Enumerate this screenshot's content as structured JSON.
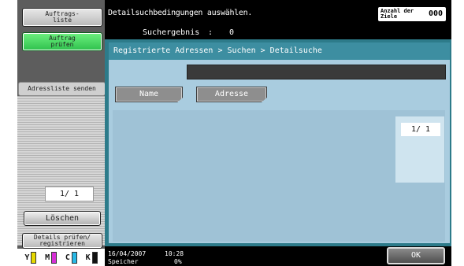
{
  "left_panel": {
    "auftragsliste_label": "Auftrags-\nliste",
    "auftrag_pruefen_label": "Auftrag\nprüfen",
    "adressliste_label": "Adressliste senden",
    "page_indicator": "1/  1",
    "loeschen_label": "Löschen",
    "details_label": "Details prüfen/\nregistrieren",
    "toner": [
      {
        "letter": "Y",
        "color": "#e6d800"
      },
      {
        "letter": "M",
        "color": "#d62fd6"
      },
      {
        "letter": "C",
        "color": "#28b8e6"
      },
      {
        "letter": "K",
        "color": "#111111"
      }
    ]
  },
  "header": {
    "instruction": "Detailsuchbedingungen auswählen.",
    "result_label": "Suchergebnis",
    "result_colon": ":",
    "result_value": "0",
    "counter_label": "Anzahl der\nZiele",
    "counter_value": "000"
  },
  "main": {
    "breadcrumb": "Registrierte Adressen > Suchen > Detailsuche",
    "tabs": [
      {
        "label": "Name"
      },
      {
        "label": "Adresse"
      }
    ],
    "page_indicator": "1/  1"
  },
  "footer": {
    "date": "16/04/2007",
    "time": "10:28",
    "memory_label": "Speicher",
    "memory_value": "0%",
    "ok_label": "OK"
  },
  "colors": {
    "accent_teal": "#2d7b8a",
    "panel_blue": "#a9ccdf",
    "active_green": "#2fc14d"
  }
}
